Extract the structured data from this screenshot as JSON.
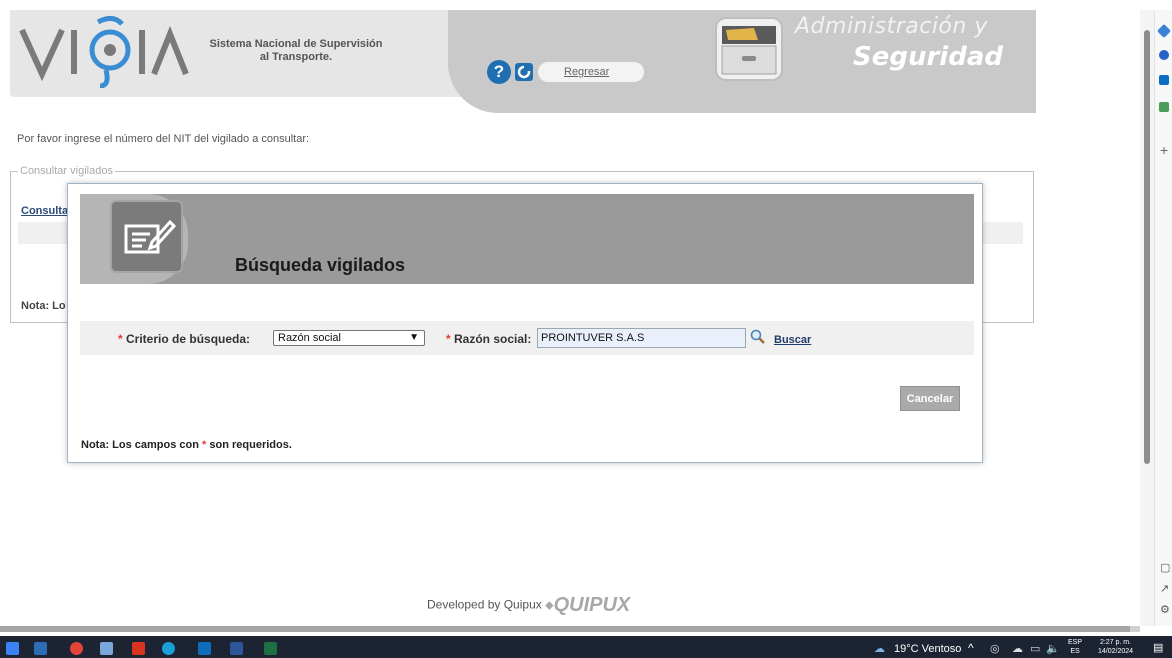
{
  "header": {
    "logo_text": "VIGIA",
    "system_title_line1": "Sistema Nacional de Supervisión",
    "system_title_line2": "al Transporte.",
    "back_link": "Regresar",
    "admin_line1": "Administración y",
    "admin_line2": "Seguridad"
  },
  "page": {
    "instructions": "Por favor ingrese el número del NIT del vigilado a consultar:",
    "fieldset_legend": "Consultar vigilados",
    "consult_link_partial": "Consulta",
    "nota_partial": "Nota: Lo"
  },
  "modal": {
    "title": "Búsqueda vigilados",
    "criteria_label": "Criterio de búsqueda:",
    "criteria_value": "Razón social",
    "field_label": "Razón social:",
    "field_value": "PROINTUVER S.A.S",
    "search_label": "Buscar",
    "cancel_label": "Cancelar",
    "note_prefix": "Nota: Los campos con",
    "note_star": "*",
    "note_suffix": "son requeridos.",
    "required_marker": "*"
  },
  "footer": {
    "developed_by": "Developed by Quipux",
    "brand": "QUIPUX"
  },
  "taskbar": {
    "weather": "19°C  Ventoso",
    "lang_top": "ESP",
    "lang_bottom": "ES",
    "time": "2:27 p. m.",
    "date": "14/02/2024"
  },
  "colors": {
    "accent_blue": "#1f6fb2",
    "required_red": "#e23b2e",
    "header_grey": "#e6e6e6",
    "modal_head_grey": "#9a9a9a",
    "taskbar_bg": "#1c2434"
  }
}
